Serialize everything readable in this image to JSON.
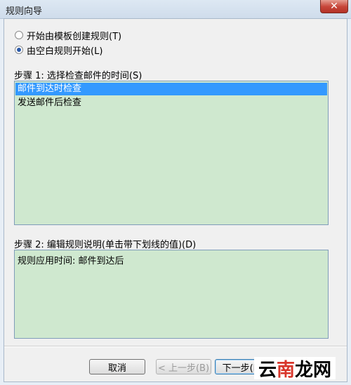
{
  "window": {
    "title": "规则向导",
    "close_label": "✕"
  },
  "options": [
    {
      "label": "开始由模板创建规则(T)",
      "checked": false
    },
    {
      "label": "由空白规则开始(L)",
      "checked": true
    }
  ],
  "step1": {
    "label": "步骤 1: 选择检查邮件的时间(S)",
    "items": [
      {
        "label": "邮件到达时检查",
        "selected": true
      },
      {
        "label": "发送邮件后检查",
        "selected": false
      }
    ]
  },
  "step2": {
    "label": "步骤 2: 编辑规则说明(单击带下划线的值)(D)",
    "description": "规则应用时间: 邮件到达后"
  },
  "buttons": {
    "cancel": "取消",
    "back": "< 上一步(B)",
    "next": "下一步(N)"
  },
  "watermark": {
    "part1": "云",
    "part2": "南",
    "part3": "龙网"
  }
}
